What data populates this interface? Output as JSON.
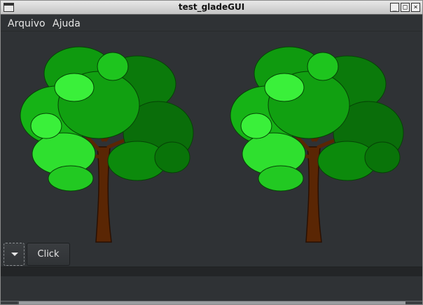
{
  "window": {
    "title": "test_gladeGUI",
    "controls": {
      "minimize": "_",
      "maximize": "□",
      "close": "×"
    }
  },
  "menu": [
    {
      "label": "Arquivo"
    },
    {
      "label": "Ajuda"
    }
  ],
  "images": [
    {
      "name": "tree-image-left",
      "icon": "tree"
    },
    {
      "name": "tree-image-right",
      "icon": "tree"
    }
  ],
  "toolbar": {
    "dropdown_icon": "chevron-down-icon",
    "click_label": "Click"
  },
  "colors": {
    "window_bg": "#2f3235",
    "text": "#e6e6e6",
    "leaf_dark": "#0b7a0b",
    "leaf_mid": "#13a313",
    "leaf_light": "#2fe02f",
    "trunk": "#5a2604"
  }
}
